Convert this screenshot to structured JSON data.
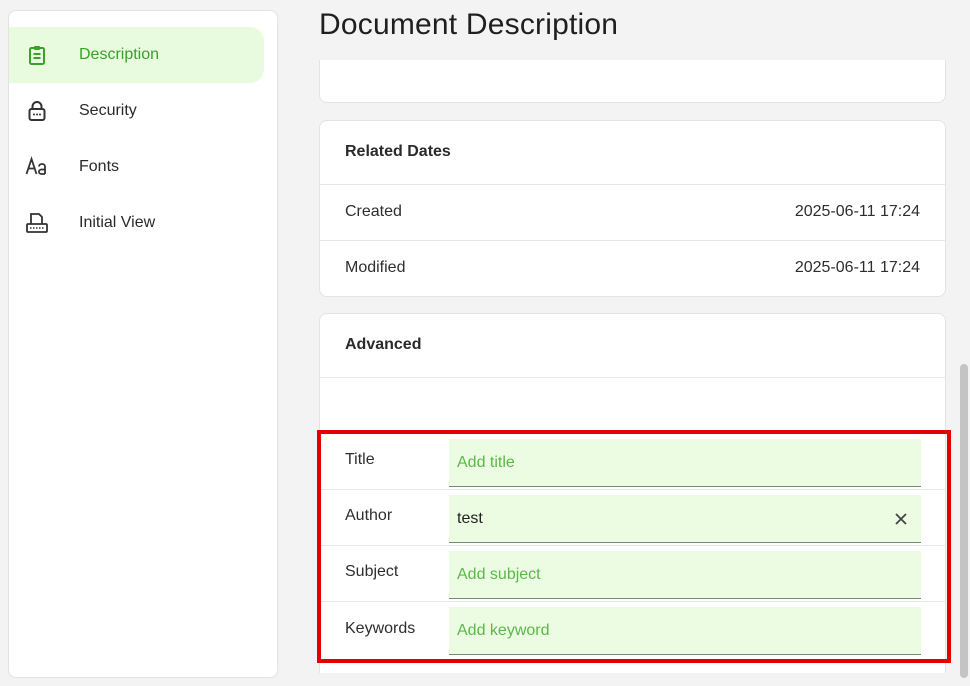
{
  "sidebar": {
    "items": [
      {
        "label": "Description",
        "icon": "clipboard-icon",
        "active": true
      },
      {
        "label": "Security",
        "icon": "lock-icon",
        "active": false
      },
      {
        "label": "Fonts",
        "icon": "font-icon",
        "active": false
      },
      {
        "label": "Initial View",
        "icon": "print-view-icon",
        "active": false
      }
    ]
  },
  "page": {
    "title": "Document Description"
  },
  "dates": {
    "header": "Related Dates",
    "created_label": "Created",
    "created_value": "2025-06-11 17:24",
    "modified_label": "Modified",
    "modified_value": "2025-06-11 17:24"
  },
  "advanced": {
    "header": "Advanced",
    "fields": [
      {
        "label": "Title",
        "value": "",
        "placeholder": "Add title"
      },
      {
        "label": "Author",
        "value": "test",
        "placeholder": ""
      },
      {
        "label": "Subject",
        "value": "",
        "placeholder": "Add subject"
      },
      {
        "label": "Keywords",
        "value": "",
        "placeholder": "Add keyword"
      }
    ]
  },
  "colors": {
    "accent": "#3aa02a",
    "active_bg": "#e8fbdf",
    "field_bg": "#ebfce2",
    "highlight": "#e30000"
  }
}
